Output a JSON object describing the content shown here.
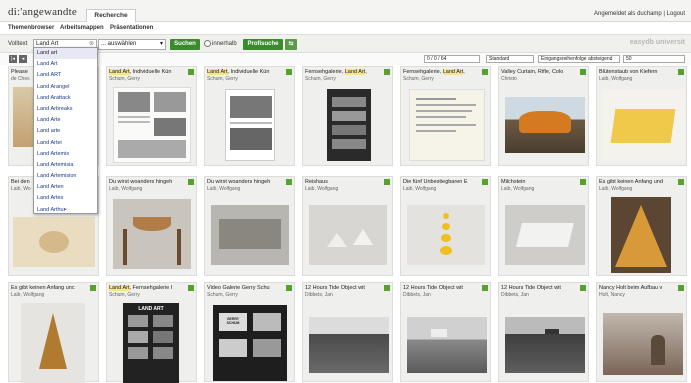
{
  "app": {
    "logo": "di:'angewandte",
    "tab_recherche": "Recherche",
    "user_status": "Angemeldet als duchamp | Logout",
    "brand": "easydb universit"
  },
  "nav": {
    "themenbrowser": "Themenbrowser",
    "arbeitsmappen": "Arbeitsmappen",
    "praesentationen": "Präsentationen"
  },
  "search": {
    "label": "Volltext",
    "value": "Land Art",
    "scope": "... auswählen",
    "suchen": "Suchen",
    "innerhalb": "innerhalb",
    "profisuche": "Profisuche"
  },
  "toolbar": {
    "count": "0 / 0 / 64",
    "view": "Standard",
    "sort": "Eingangsreihenfolge absteigend",
    "per_page": "50"
  },
  "dropdown": {
    "items": [
      "Land art",
      "Land Art",
      "Land ART",
      "Land Arangel",
      "Land Arattack",
      "Land Arbreaks",
      "Land Arte",
      "Land arte",
      "Land Artei",
      "Land Artemis",
      "Land Artemisia",
      "Land Artemision",
      "Land Arten",
      "Land Artes",
      "Land Arthur"
    ]
  },
  "cards": [
    {
      "title": "Please",
      "hl": "",
      "rest": "",
      "author": "de Ches"
    },
    {
      "title": "",
      "hl": "Land Art",
      "rest": ", Individuelle Kün",
      "author": "Schum, Gerry"
    },
    {
      "title": "",
      "hl": "Land Art",
      "rest": ", Individuelle Kün",
      "author": "Schum, Gerry"
    },
    {
      "title": "Fernsehgalerie, ",
      "hl": "Land Art",
      "rest": ",",
      "author": "Schum, Gerry"
    },
    {
      "title": "Fernsehgalerie, ",
      "hl": "Land Art",
      "rest": ",",
      "author": "Schum, Gerry"
    },
    {
      "title": "Valley Curtain, Rifle, Colo",
      "hl": "",
      "rest": "",
      "author": "Christo"
    },
    {
      "title": "Blütenstaub von Kiefern",
      "hl": "",
      "rest": "",
      "author": "Laib, Wolfgang"
    },
    {
      "title": "Bei den",
      "hl": "",
      "rest": "",
      "author": "Laib, Wo"
    },
    {
      "title": "Du wirst woanders hingeh",
      "hl": "",
      "rest": "",
      "author": "Laib, Wolfgang"
    },
    {
      "title": "Du wirst woanders hingeh",
      "hl": "",
      "rest": "",
      "author": "Laib, Wolfgang"
    },
    {
      "title": "Reishaus",
      "hl": "",
      "rest": "",
      "author": "Laib, Wolfgang"
    },
    {
      "title": "Die fünf Unbestiegbaren E",
      "hl": "",
      "rest": "",
      "author": "Laib, Wolfgang"
    },
    {
      "title": "Milchstein",
      "hl": "",
      "rest": "",
      "author": "Laib, Wolfgang"
    },
    {
      "title": "Es gibt keinen Anfang und",
      "hl": "",
      "rest": "",
      "author": "Laib, Wolfgang"
    },
    {
      "title": "Es gibt keinen Anfang unc",
      "hl": "",
      "rest": "",
      "author": "Laib, Wolfgang"
    },
    {
      "title": "",
      "hl": "Land Art",
      "rest": ", Fernsehgalerie I",
      "author": "Schum, Gerry"
    },
    {
      "title": "Video Galerie Gerry Schu",
      "hl": "",
      "rest": "",
      "author": "Schum, Gerry"
    },
    {
      "title": "12 Hours Tide Object wit",
      "hl": "",
      "rest": "",
      "author": "Dibbets, Jan"
    },
    {
      "title": "12 Hours Tide Object wit",
      "hl": "",
      "rest": "",
      "author": "Dibbets, Jan"
    },
    {
      "title": "12 Hours Tide Object wit",
      "hl": "",
      "rest": "",
      "author": "Dibbets, Jan"
    },
    {
      "title": "Nancy Holt beim Aufbau v",
      "hl": "",
      "rest": "",
      "author": "Holt, Nancy"
    }
  ],
  "poster_text": {
    "land_art": "LAND ART",
    "gerry_schum": "GERRY SCHUM"
  }
}
